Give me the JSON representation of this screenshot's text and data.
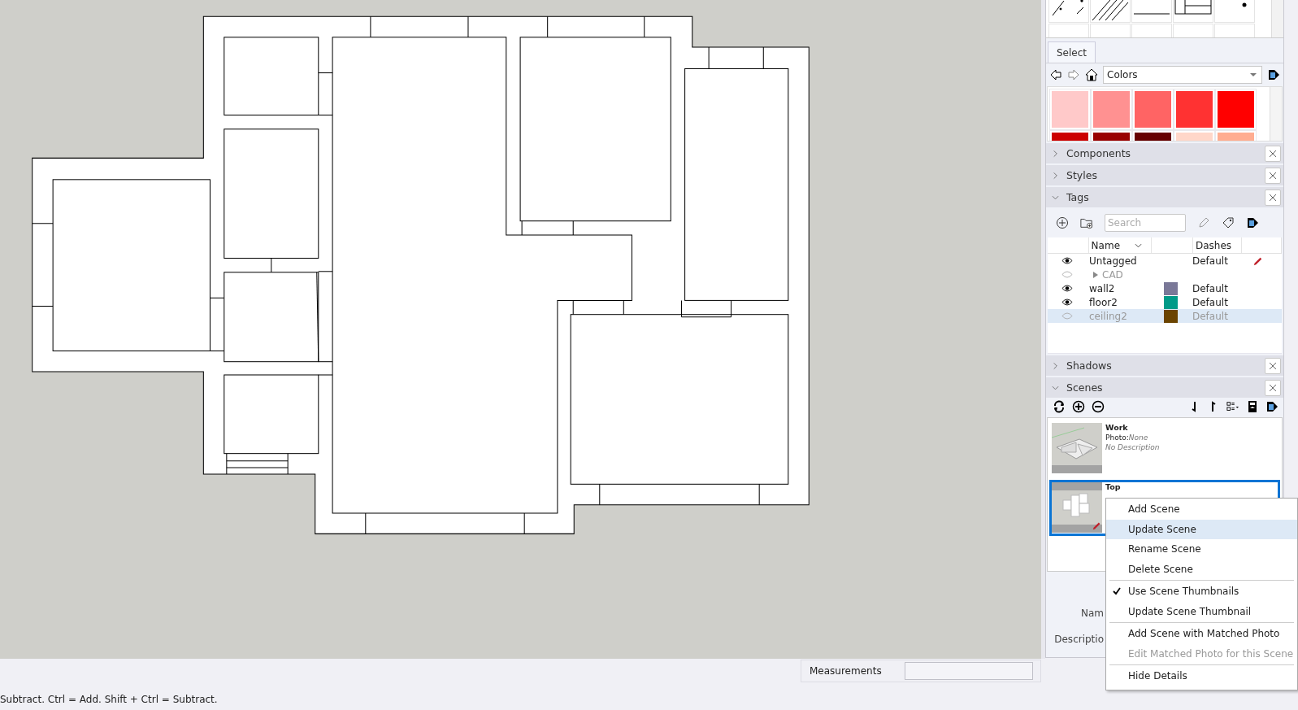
{
  "materials": {
    "tab": {
      "label": "Select",
      "selected": true
    },
    "library": "Colors",
    "swatches": [
      {
        "color": "#ffc9c9"
      },
      {
        "color": "#ff9191"
      },
      {
        "color": "#ff6464"
      },
      {
        "color": "#ff3232"
      },
      {
        "color": "#ff0000"
      },
      {
        "color": "#cc0000"
      },
      {
        "color": "#990000"
      },
      {
        "color": "#660000"
      },
      {
        "color": "#ffd7c9"
      },
      {
        "color": "#ffad91"
      }
    ]
  },
  "components": {
    "title": "Components",
    "expanded": false
  },
  "styles": {
    "title": "Styles",
    "expanded": false
  },
  "tags": {
    "title": "Tags",
    "expanded": true,
    "search": {
      "placeholder": "Search"
    },
    "columns": [
      "Name",
      "Dashes"
    ],
    "rows": [
      {
        "kind": "tag",
        "name": "Untagged",
        "visible": true,
        "dashes": "Default",
        "active": true,
        "selected": false
      },
      {
        "kind": "folder",
        "name": "CAD",
        "visible": false,
        "expanded": false,
        "active": false,
        "selected": false
      },
      {
        "kind": "tag",
        "name": "wall2",
        "visible": true,
        "color": "#7a7898",
        "dashes": "Default",
        "active": false,
        "selected": false
      },
      {
        "kind": "tag",
        "name": "floor2",
        "visible": true,
        "color": "#009a88",
        "dashes": "Default",
        "active": false,
        "selected": false
      },
      {
        "kind": "tag",
        "name": "ceiling2",
        "visible": false,
        "color": "#6b4400",
        "dashes": "Default",
        "active": false,
        "selected": true
      }
    ]
  },
  "shadows": {
    "title": "Shadows",
    "expanded": false
  },
  "scenes": {
    "title": "Scenes",
    "expanded": true,
    "items": [
      {
        "name": "Work",
        "photo_label": "Photo:",
        "photo": "None",
        "description": "No Description",
        "selected": false,
        "kind": "perspective"
      },
      {
        "name": "Top",
        "selected": true,
        "kind": "plan"
      }
    ],
    "details": {
      "name_label": "Nam",
      "description_label": "Descriptio"
    }
  },
  "context_menu": {
    "items": [
      {
        "kind": "item",
        "label": "Add Scene",
        "checked": false,
        "disabled": false,
        "selected": false
      },
      {
        "kind": "item",
        "label": "Update Scene",
        "checked": false,
        "disabled": false,
        "selected": true
      },
      {
        "kind": "item",
        "label": "Rename Scene",
        "checked": false,
        "disabled": false,
        "selected": false
      },
      {
        "kind": "item",
        "label": "Delete Scene",
        "checked": false,
        "disabled": false,
        "selected": false
      },
      {
        "kind": "separator"
      },
      {
        "kind": "item",
        "label": "Use Scene Thumbnails",
        "checked": true,
        "disabled": false,
        "selected": false
      },
      {
        "kind": "item",
        "label": "Update Scene Thumbnail",
        "checked": false,
        "disabled": false,
        "selected": false
      },
      {
        "kind": "separator"
      },
      {
        "kind": "item",
        "label": "Add Scene with Matched Photo",
        "checked": false,
        "disabled": false,
        "selected": false
      },
      {
        "kind": "item",
        "label": "Edit Matched Photo for this Scene",
        "checked": false,
        "disabled": true,
        "selected": false
      },
      {
        "kind": "separator"
      },
      {
        "kind": "item",
        "label": "Hide Details",
        "checked": false,
        "disabled": false,
        "selected": false
      }
    ]
  },
  "status_bar": {
    "hint": "Subtract. Ctrl = Add. Shift + Ctrl = Subtract.",
    "measurements_label": "Measurements"
  }
}
